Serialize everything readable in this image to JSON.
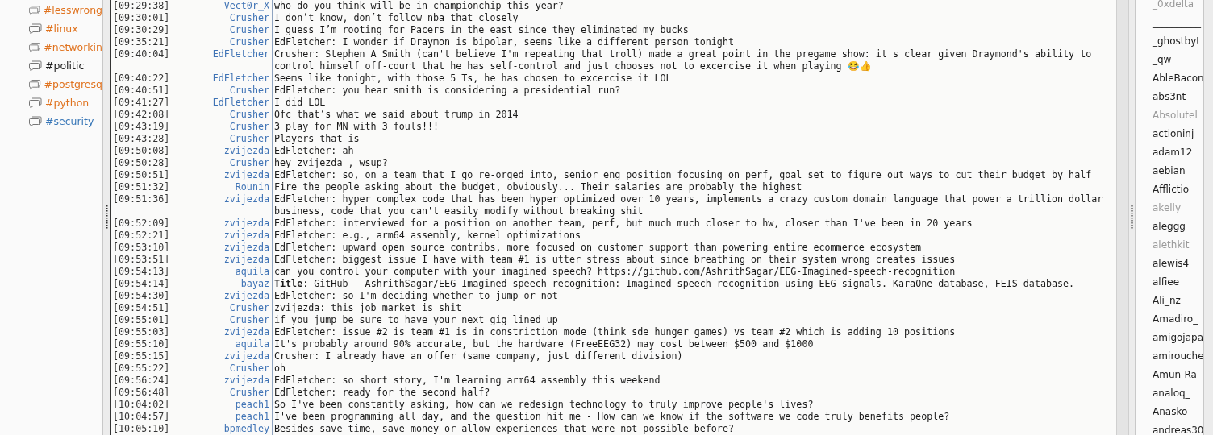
{
  "channels": [
    {
      "name": "#lesswrong",
      "color": "#e0731f"
    },
    {
      "name": "#linux",
      "color": "#e0731f"
    },
    {
      "name": "#networkin",
      "color": "#e0731f"
    },
    {
      "name": "#politic",
      "color": "#222222"
    },
    {
      "name": "#postgresq",
      "color": "#e0731f"
    },
    {
      "name": "#python",
      "color": "#e0731f"
    },
    {
      "name": "#security",
      "color": "#3a78b8"
    }
  ],
  "messages": [
    {
      "time": "[09:29:38]",
      "nick": "Vect0r_X",
      "text": "who do you think will be in championchip this year?"
    },
    {
      "time": "[09:30:01]",
      "nick": "Crusher",
      "text": "I don’t know, don’t follow nba that closely"
    },
    {
      "time": "[09:30:29]",
      "nick": "Crusher",
      "text": "I guess I’m rooting for Pacers in the east since they eliminated my bucks"
    },
    {
      "time": "[09:35:21]",
      "nick": "Crusher",
      "text": "EdFletcher: I wonder if Draymon is bipolar, seems like a different person tonight"
    },
    {
      "time": "[09:40:04]",
      "nick": "EdFletcher",
      "text": "Crusher: Stephen A Smith (can't believe I'm repeating that troll) made a great point in the pregame show: it's clear given Draymond's ability to control himself off-court that he has self-control and just chooses not to excercise it when playing 😂👍"
    },
    {
      "time": "[09:40:22]",
      "nick": "EdFletcher",
      "text": "Seems like tonight, with those 5 Ts, he has chosen to excercise it LOL"
    },
    {
      "time": "[09:40:51]",
      "nick": "Crusher",
      "text": "EdFletcher: you hear smith is considering a presidential run?"
    },
    {
      "time": "[09:41:27]",
      "nick": "EdFletcher",
      "text": "I did LOL"
    },
    {
      "time": "[09:42:08]",
      "nick": "Crusher",
      "text": "Ofc that’s what we said about trump in 2014"
    },
    {
      "time": "[09:43:19]",
      "nick": "Crusher",
      "text": "3 play for MN with 3 fouls!!!"
    },
    {
      "time": "[09:43:28]",
      "nick": "Crusher",
      "text": "Players that is"
    },
    {
      "time": "[09:50:08]",
      "nick": "zvijezda",
      "text": "EdFletcher: ah"
    },
    {
      "time": "[09:50:28]",
      "nick": "Crusher",
      "text": "hey zvijezda , wsup?"
    },
    {
      "time": "[09:50:51]",
      "nick": "zvijezda",
      "text": "EdFletcher: so, on a team that I go re-orged into, senior eng position focusing on perf, goal set to figure out ways to cut their budget by half"
    },
    {
      "time": "[09:51:32]",
      "nick": "Rounin",
      "text": "Fire the people asking about the budget, obviously... Their salaries are probably the highest"
    },
    {
      "time": "[09:51:36]",
      "nick": "zvijezda",
      "text": "EdFletcher: hyper complex code that has been hyper optimized over 10 years, implements a crazy custom domain language that power a trillion dollar business, code that you can't easily modify without breaking shit"
    },
    {
      "time": "[09:52:09]",
      "nick": "zvijezda",
      "text": "EdFletcher: interviewed for a position on another team, perf, but much much closer to hw, closer than I've been in 20 years"
    },
    {
      "time": "[09:52:21]",
      "nick": "zvijezda",
      "text": "EdFletcher: e.g., arm64 assembly, kernel optimizations"
    },
    {
      "time": "[09:53:10]",
      "nick": "zvijezda",
      "text": "EdFletcher: upward open source contribs, more focused on customer support than powering entire ecommerce ecosystem"
    },
    {
      "time": "[09:53:51]",
      "nick": "zvijezda",
      "text": "EdFletcher: biggest issue I have with team #1 is utter stress about since breathing on their system wrong creates issues"
    },
    {
      "time": "[09:54:13]",
      "nick": "aquila",
      "text": "can you control your computer with your imagined speech? https://github.com/AshrithSagar/EEG-Imagined-speech-recognition"
    },
    {
      "time": "[09:54:14]",
      "nick": "bayaz",
      "text": "**Title**: GitHub - AshrithSagar/EEG-Imagined-speech-recognition: Imagined speech recognition using EEG signals. KaraOne database, FEIS database."
    },
    {
      "time": "[09:54:30]",
      "nick": "zvijezda",
      "text": "EdFletcher: so I'm deciding whether to jump or not"
    },
    {
      "time": "[09:54:51]",
      "nick": "Crusher",
      "text": "zvijezda: this job market is shit"
    },
    {
      "time": "[09:55:01]",
      "nick": "Crusher",
      "text": "if you jump be sure to have your next gig lined up"
    },
    {
      "time": "[09:55:03]",
      "nick": "zvijezda",
      "text": "EdFletcher: issue #2 is team #1 is in constriction mode (think sde hunger games) vs team #2 which is adding 10 positions"
    },
    {
      "time": "[09:55:10]",
      "nick": "aquila",
      "text": "It's probably around 90% accurate, but the hardware (FreeEEG32) may cost between $500 and $1000"
    },
    {
      "time": "[09:55:15]",
      "nick": "zvijezda",
      "text": "Crusher: I already have an offer (same company, just different division)"
    },
    {
      "time": "[09:55:22]",
      "nick": "Crusher",
      "text": "oh"
    },
    {
      "time": "[09:56:24]",
      "nick": "zvijezda",
      "text": "EdFletcher: so short story, I'm learning arm64 assembly this weekend"
    },
    {
      "time": "[09:56:48]",
      "nick": "Crusher",
      "text": "EdFletcher: ready for the second half?"
    },
    {
      "time": "[10:04:02]",
      "nick": "peach1",
      "text": "So I've been constantly asking, how can we redesign technology to truly improve people's lives?"
    },
    {
      "time": "[10:04:57]",
      "nick": "peach1",
      "text": "I've been programming all day, and the question hit me - How can we know if the software we code truly benefits people?"
    },
    {
      "time": "[10:05:10]",
      "nick": "bpmedley",
      "text": "Besides save time, save money or allow experiences that were not possible before?"
    }
  ],
  "users": [
    {
      "name": "_0xdelta",
      "away": true
    },
    {
      "name": "__________",
      "away": false
    },
    {
      "name": "_ghostbyt",
      "away": false
    },
    {
      "name": "_qw",
      "away": false
    },
    {
      "name": "AbleBacon",
      "away": false
    },
    {
      "name": "abs3nt",
      "away": false
    },
    {
      "name": "Absolutel",
      "away": true
    },
    {
      "name": "actioninj",
      "away": false
    },
    {
      "name": "adam12",
      "away": false
    },
    {
      "name": "aebian",
      "away": false
    },
    {
      "name": "Afflictio",
      "away": false
    },
    {
      "name": "akelly",
      "away": true
    },
    {
      "name": "aleggg",
      "away": false
    },
    {
      "name": "alethkit",
      "away": true
    },
    {
      "name": "alewis4",
      "away": false
    },
    {
      "name": "alfiee",
      "away": false
    },
    {
      "name": "Ali_nz",
      "away": false
    },
    {
      "name": "Amadiro_",
      "away": false
    },
    {
      "name": "amigojapa",
      "away": false
    },
    {
      "name": "amirouche",
      "away": false
    },
    {
      "name": "Amun-Ra",
      "away": false
    },
    {
      "name": "analoq_",
      "away": false
    },
    {
      "name": "Anasko",
      "away": false
    },
    {
      "name": "andreas30",
      "away": false
    }
  ]
}
